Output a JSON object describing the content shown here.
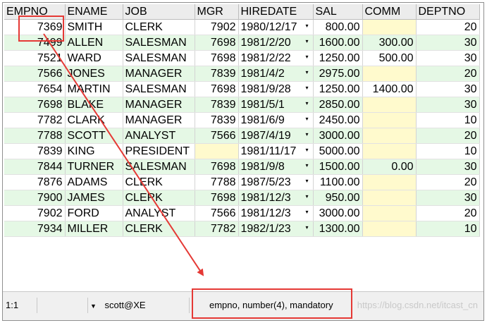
{
  "columns": [
    "EMPNO",
    "ENAME",
    "JOB",
    "MGR",
    "HIREDATE",
    "SAL",
    "COMM",
    "DEPTNO"
  ],
  "rows": [
    {
      "empno": "7369",
      "ename": "SMITH",
      "job": "CLERK",
      "mgr": "7902",
      "hiredate": "1980/12/17",
      "sal": "800.00",
      "comm": "",
      "deptno": "20"
    },
    {
      "empno": "7499",
      "ename": "ALLEN",
      "job": "SALESMAN",
      "mgr": "7698",
      "hiredate": "1981/2/20",
      "sal": "1600.00",
      "comm": "300.00",
      "deptno": "30"
    },
    {
      "empno": "7521",
      "ename": "WARD",
      "job": "SALESMAN",
      "mgr": "7698",
      "hiredate": "1981/2/22",
      "sal": "1250.00",
      "comm": "500.00",
      "deptno": "30"
    },
    {
      "empno": "7566",
      "ename": "JONES",
      "job": "MANAGER",
      "mgr": "7839",
      "hiredate": "1981/4/2",
      "sal": "2975.00",
      "comm": "",
      "deptno": "20"
    },
    {
      "empno": "7654",
      "ename": "MARTIN",
      "job": "SALESMAN",
      "mgr": "7698",
      "hiredate": "1981/9/28",
      "sal": "1250.00",
      "comm": "1400.00",
      "deptno": "30"
    },
    {
      "empno": "7698",
      "ename": "BLAKE",
      "job": "MANAGER",
      "mgr": "7839",
      "hiredate": "1981/5/1",
      "sal": "2850.00",
      "comm": "",
      "deptno": "30"
    },
    {
      "empno": "7782",
      "ename": "CLARK",
      "job": "MANAGER",
      "mgr": "7839",
      "hiredate": "1981/6/9",
      "sal": "2450.00",
      "comm": "",
      "deptno": "10"
    },
    {
      "empno": "7788",
      "ename": "SCOTT",
      "job": "ANALYST",
      "mgr": "7566",
      "hiredate": "1987/4/19",
      "sal": "3000.00",
      "comm": "",
      "deptno": "20"
    },
    {
      "empno": "7839",
      "ename": "KING",
      "job": "PRESIDENT",
      "mgr": "",
      "hiredate": "1981/11/17",
      "sal": "5000.00",
      "comm": "",
      "deptno": "10"
    },
    {
      "empno": "7844",
      "ename": "TURNER",
      "job": "SALESMAN",
      "mgr": "7698",
      "hiredate": "1981/9/8",
      "sal": "1500.00",
      "comm": "0.00",
      "deptno": "30"
    },
    {
      "empno": "7876",
      "ename": "ADAMS",
      "job": "CLERK",
      "mgr": "7788",
      "hiredate": "1987/5/23",
      "sal": "1100.00",
      "comm": "",
      "deptno": "20"
    },
    {
      "empno": "7900",
      "ename": "JAMES",
      "job": "CLERK",
      "mgr": "7698",
      "hiredate": "1981/12/3",
      "sal": "950.00",
      "comm": "",
      "deptno": "30"
    },
    {
      "empno": "7902",
      "ename": "FORD",
      "job": "ANALYST",
      "mgr": "7566",
      "hiredate": "1981/12/3",
      "sal": "3000.00",
      "comm": "",
      "deptno": "20"
    },
    {
      "empno": "7934",
      "ename": "MILLER",
      "job": "CLERK",
      "mgr": "7782",
      "hiredate": "1982/1/23",
      "sal": "1300.00",
      "comm": "",
      "deptno": "10"
    }
  ],
  "statusbar": {
    "position": "1:1",
    "dropdown_arrow": "▼",
    "connection": "scott@XE",
    "field_info": "empno, number(4), mandatory",
    "watermark": "https://blog.csdn.net/itcast_cn"
  },
  "icons": {
    "date_dropdown": "▾",
    "header_dropdown": "▾"
  },
  "colors": {
    "row_alt": "#e5f8e5",
    "null_cell": "#fffacd",
    "highlight": "#e53935"
  }
}
